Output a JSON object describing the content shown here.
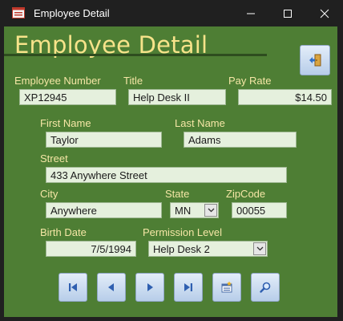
{
  "window": {
    "title": "Employee Detail",
    "icons": {
      "app": "access-form-icon",
      "minimize": "minimize-icon",
      "maximize": "maximize-icon",
      "close": "close-icon"
    }
  },
  "form": {
    "heading": "Employee Detail",
    "exit_icon": "exit-door-icon",
    "fields": {
      "employee_number": {
        "label": "Employee Number",
        "value": "XP12945"
      },
      "title": {
        "label": "Title",
        "value": "Help Desk II"
      },
      "pay_rate": {
        "label": "Pay Rate",
        "value": "$14.50"
      },
      "first_name": {
        "label": "First Name",
        "value": "Taylor"
      },
      "last_name": {
        "label": "Last Name",
        "value": "Adams"
      },
      "street": {
        "label": "Street",
        "value": "433 Anywhere Street"
      },
      "city": {
        "label": "City",
        "value": "Anywhere"
      },
      "state": {
        "label": "State",
        "value": "MN"
      },
      "zipcode": {
        "label": "ZipCode",
        "value": "00055"
      },
      "birth_date": {
        "label": "Birth Date",
        "value": "7/5/1994"
      },
      "permission_level": {
        "label": "Permission Level",
        "value": "Help Desk 2"
      }
    },
    "nav_buttons": [
      {
        "icon": "first-record-icon"
      },
      {
        "icon": "previous-record-icon"
      },
      {
        "icon": "next-record-icon"
      },
      {
        "icon": "last-record-icon"
      },
      {
        "icon": "new-record-icon"
      },
      {
        "icon": "find-icon"
      }
    ]
  },
  "colors": {
    "form_background": "#4e7e34",
    "heading": "#f7e38a",
    "label": "#f5e6a6",
    "field_background": "#e5f0dd",
    "titlebar": "#202020"
  }
}
